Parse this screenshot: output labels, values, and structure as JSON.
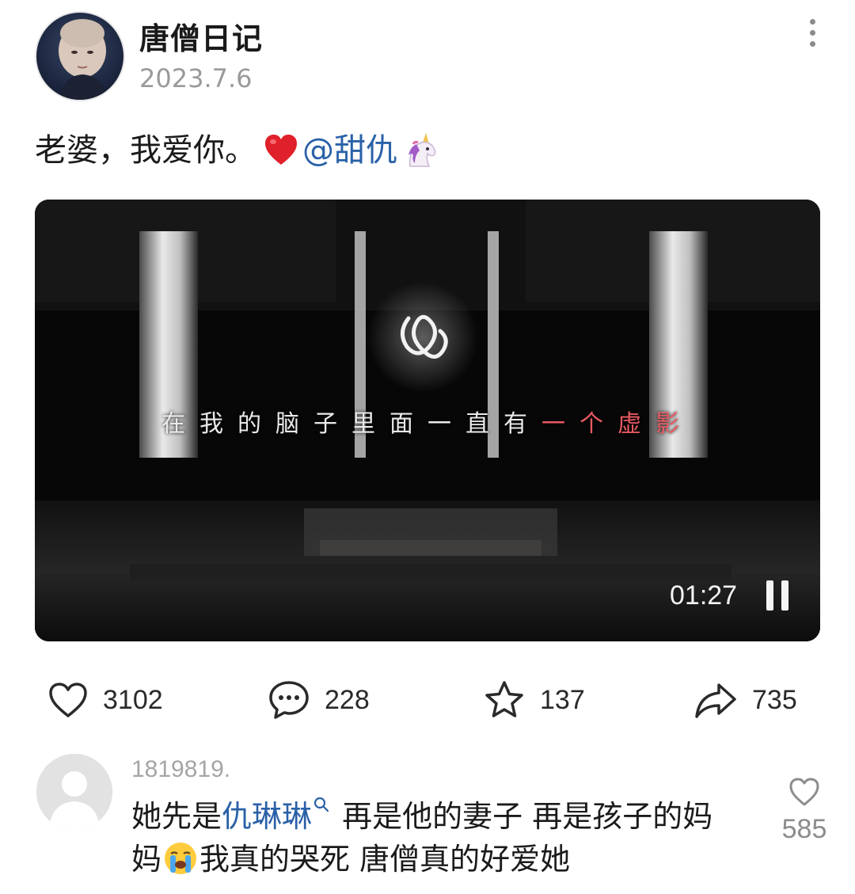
{
  "post": {
    "author": "唐僧日记",
    "date": "2023.7.6",
    "text": "老婆，我爱你。",
    "mention": "@甜仇",
    "emojis": [
      "red-heart",
      "unicorn"
    ]
  },
  "video": {
    "subtitle_main": "在我的脑子里面一直有",
    "subtitle_highlight": "一个虚影",
    "duration": "01:27",
    "state": "playing",
    "highlight_color": "#e85b62"
  },
  "actions": {
    "likes": "3102",
    "comments": "228",
    "favorites": "137",
    "shares": "735"
  },
  "comment": {
    "username": "1819819.",
    "text_prefix": "她先是",
    "mention": "仇琳琳",
    "text_middle": " 再是他的妻子 再是孩子的妈妈",
    "text_suffix": "我真的哭死 唐僧真的好爱她",
    "likes": "585"
  },
  "colors": {
    "link": "#2a61a8",
    "muted": "#9a9a9a"
  }
}
